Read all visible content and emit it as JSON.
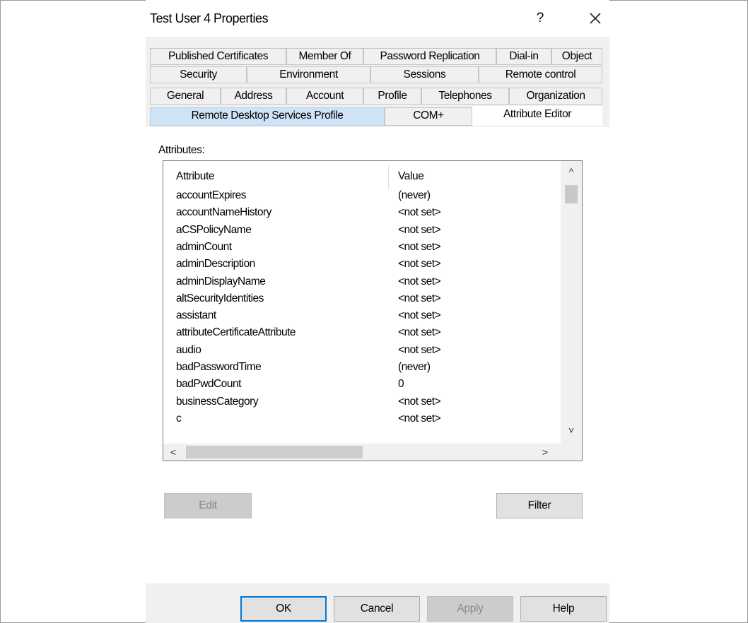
{
  "window": {
    "title": "Test User 4 Properties",
    "help_glyph": "?",
    "close_icon": "close-icon"
  },
  "tabs": {
    "row1": [
      "Published Certificates",
      "Member Of",
      "Password Replication",
      "Dial-in",
      "Object"
    ],
    "row2": [
      "Security",
      "Environment",
      "Sessions",
      "Remote control"
    ],
    "row3": [
      "General",
      "Address",
      "Account",
      "Profile",
      "Telephones",
      "Organization"
    ],
    "row4": [
      "Remote Desktop Services Profile",
      "COM+",
      "Attribute Editor"
    ],
    "active": "Attribute Editor"
  },
  "attribute_editor": {
    "label": "Attributes:",
    "columns": [
      "Attribute",
      "Value"
    ],
    "rows": [
      {
        "attribute": "accountExpires",
        "value": "(never)"
      },
      {
        "attribute": "accountNameHistory",
        "value": "<not set>"
      },
      {
        "attribute": "aCSPolicyName",
        "value": "<not set>"
      },
      {
        "attribute": "adminCount",
        "value": "<not set>"
      },
      {
        "attribute": "adminDescription",
        "value": "<not set>"
      },
      {
        "attribute": "adminDisplayName",
        "value": "<not set>"
      },
      {
        "attribute": "altSecurityIdentities",
        "value": "<not set>"
      },
      {
        "attribute": "assistant",
        "value": "<not set>"
      },
      {
        "attribute": "attributeCertificateAttribute",
        "value": "<not set>"
      },
      {
        "attribute": "audio",
        "value": "<not set>"
      },
      {
        "attribute": "badPasswordTime",
        "value": "(never)"
      },
      {
        "attribute": "badPwdCount",
        "value": "0"
      },
      {
        "attribute": "businessCategory",
        "value": "<not set>"
      },
      {
        "attribute": "c",
        "value": "<not set>"
      }
    ],
    "edit_label": "Edit",
    "filter_label": "Filter",
    "scroll_up": "^",
    "scroll_down": "˅",
    "scroll_left": "<",
    "scroll_right": ">"
  },
  "footer": {
    "ok_label": "OK",
    "cancel_label": "Cancel",
    "apply_label": "Apply",
    "help_label": "Help"
  },
  "colors": {
    "dialog_bg": "#f0f0f0",
    "highlight_tab": "#cfe2f6",
    "default_button_border": "#0078d7"
  }
}
